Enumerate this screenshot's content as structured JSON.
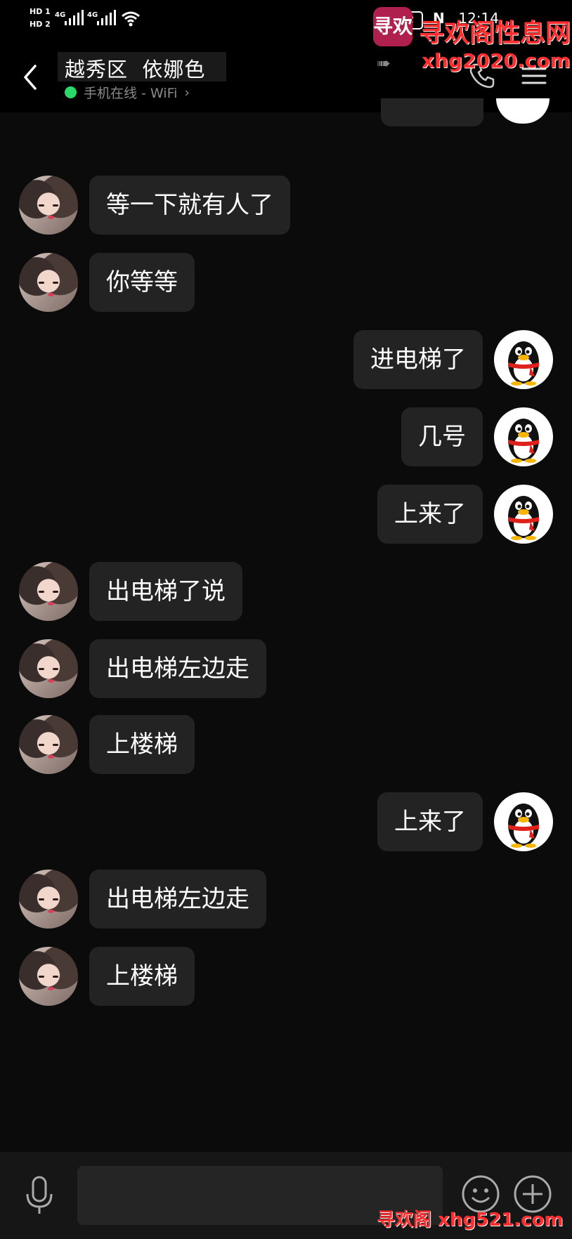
{
  "status_bar": {
    "hd1": "HD 1",
    "hd2": "HD 2",
    "net1": "4G",
    "net2": "4G",
    "battery": "22",
    "time": "12:14"
  },
  "header": {
    "title": "越秀区  依娜色",
    "online_status": "手机在线 - WiFi",
    "online_color": "#2bd96b"
  },
  "watermark": {
    "logo_text": "寻欢",
    "site_name": "寻欢阁性息网",
    "url_top": "xhg2020.com",
    "url_bottom": "寻欢阁 xhg521.com"
  },
  "messages": [
    {
      "side": "left",
      "text": "等一下就有人了"
    },
    {
      "side": "left",
      "text": "你等等"
    },
    {
      "side": "right",
      "text": "进电梯了"
    },
    {
      "side": "right",
      "text": "几号"
    },
    {
      "side": "right",
      "text": "上来了"
    },
    {
      "side": "left",
      "text": "出电梯了说"
    },
    {
      "side": "left",
      "text": "出电梯左边走"
    },
    {
      "side": "left",
      "text": "上楼梯"
    },
    {
      "side": "right",
      "text": "上来了"
    },
    {
      "side": "left",
      "text": "出电梯左边走"
    },
    {
      "side": "left",
      "text": "上楼梯"
    }
  ],
  "icons": {
    "back": "chevron-left-icon",
    "call": "phone-icon",
    "menu": "menu-icon",
    "voice": "microphone-icon",
    "emoji": "smile-icon",
    "more": "plus-icon"
  },
  "colors": {
    "background": "#0b0b0b",
    "bubble": "#232323",
    "watermark": "#ff2d2d"
  }
}
